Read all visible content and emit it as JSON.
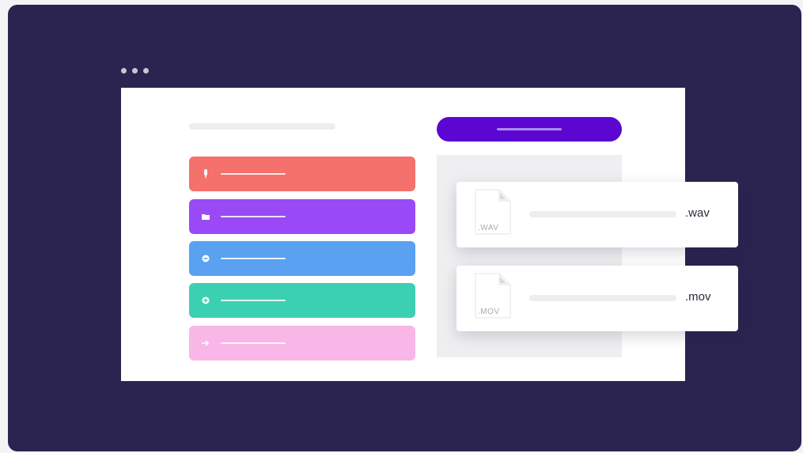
{
  "window": {
    "dots_count": 3
  },
  "list_items": [
    {
      "color": "#f4716c",
      "icon": "microphone-icon"
    },
    {
      "color": "#9949f6",
      "icon": "folder-icon"
    },
    {
      "color": "#5aa1f1",
      "icon": "record-icon"
    },
    {
      "color": "#3cd0b2",
      "icon": "plus-circle-icon"
    },
    {
      "color": "#f8b7e6",
      "icon": "arrow-right-icon"
    }
  ],
  "upload_button": {
    "color": "#5c06d2"
  },
  "files": [
    {
      "file_label": ".WAV",
      "name": ".wav"
    },
    {
      "file_label": ".MOV",
      "name": ".mov"
    }
  ]
}
